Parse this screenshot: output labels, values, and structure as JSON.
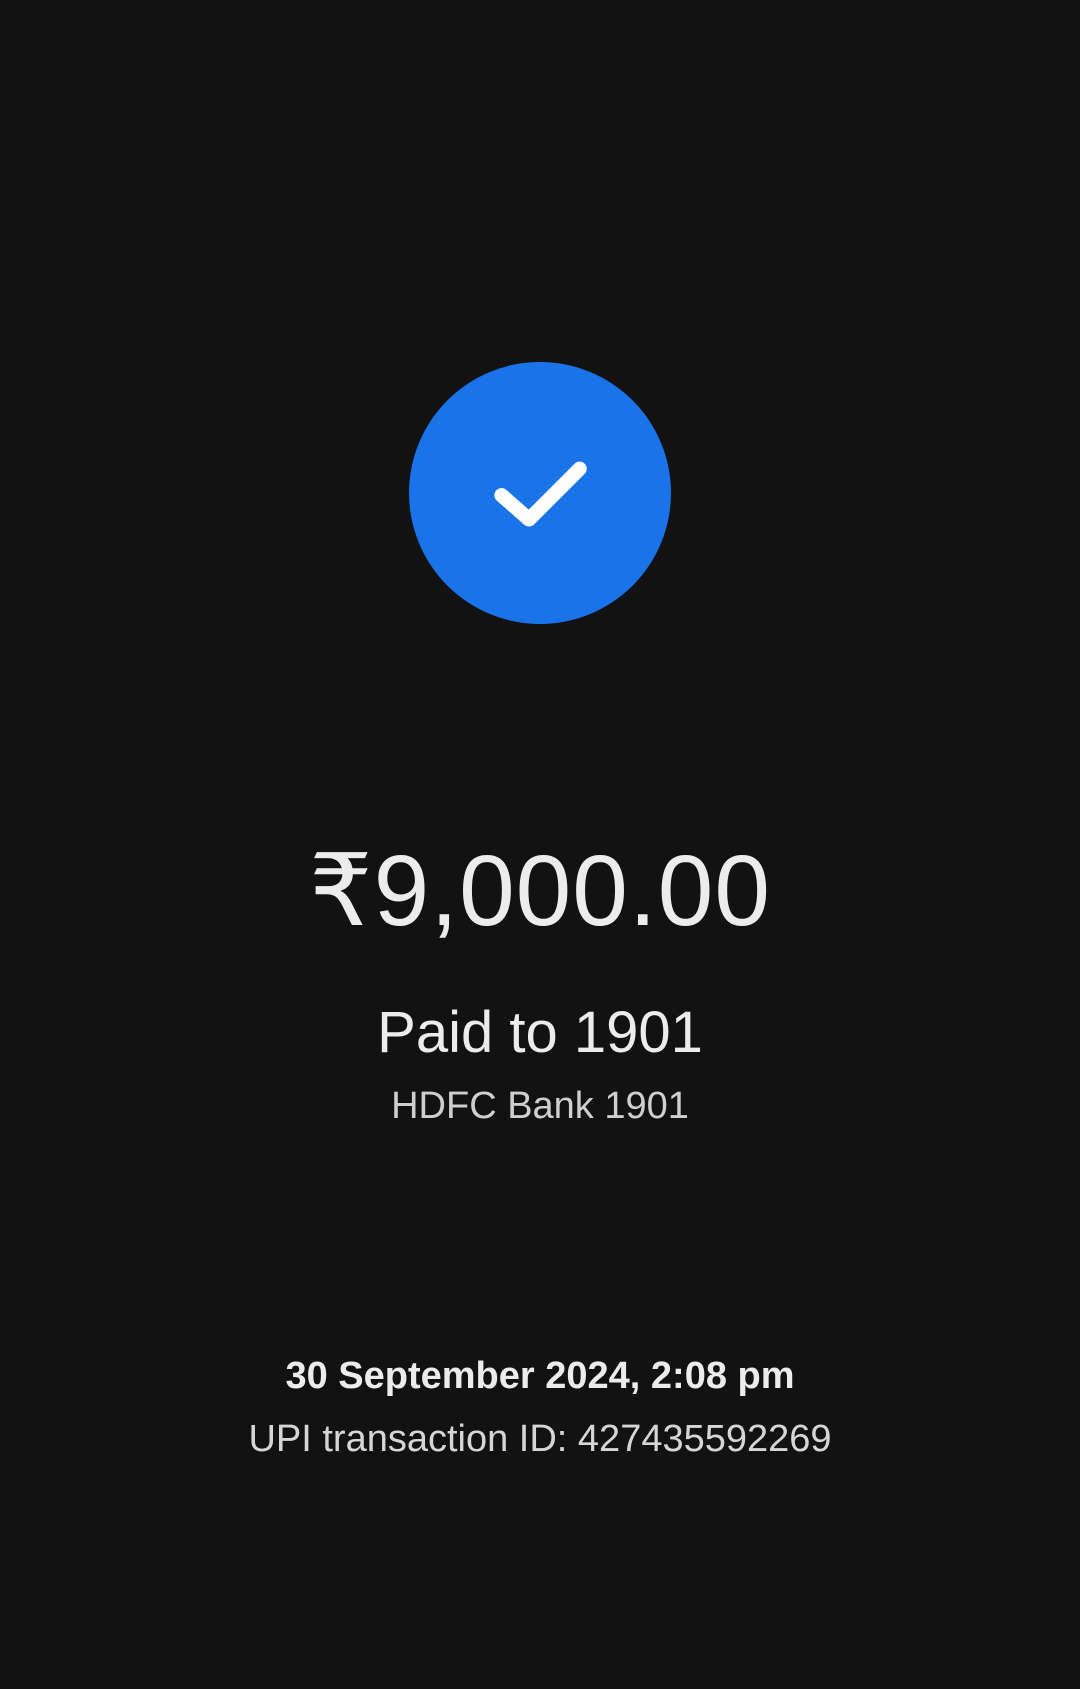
{
  "colors": {
    "background": "#121212",
    "accent": "#1a73e8",
    "text_primary": "#ececec",
    "text_secondary": "#cfcfcf"
  },
  "success_icon": "checkmark-icon",
  "payment": {
    "amount": "₹9,000.00",
    "payee": "Paid to 1901",
    "bank": "HDFC Bank 1901"
  },
  "details": {
    "datetime": "30 September 2024, 2:08 pm",
    "transaction_id": "UPI transaction ID: 427435592269"
  }
}
